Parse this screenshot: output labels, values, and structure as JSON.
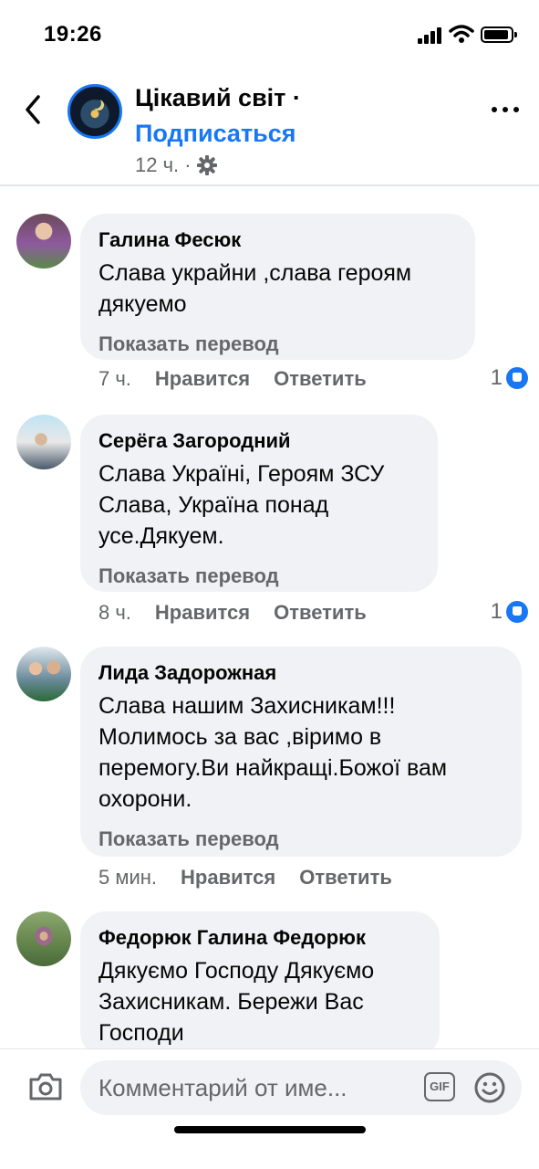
{
  "status_bar": {
    "time": "19:26"
  },
  "header": {
    "page_name": "Цікавий світ ·",
    "subscribe_label": "Подписаться",
    "post_time": "12 ч. ·"
  },
  "comments": [
    {
      "author": "Галина Фесюк",
      "text_lines": [
        "Слава украйни ,слава героям",
        "дякуемо"
      ],
      "translate_label": "Показать перевод",
      "time": "7 ч.",
      "like_label": "Нравится",
      "reply_label": "Ответить",
      "reactions": "1"
    },
    {
      "author": "Серёга Загородний",
      "text_lines": [
        "Слава Україні, Героям ЗСУ",
        "Слава, Україна понад",
        "усе.Дякуем."
      ],
      "translate_label": "Показать перевод",
      "time": "8 ч.",
      "like_label": "Нравится",
      "reply_label": "Ответить",
      "reactions": "1"
    },
    {
      "author": "Лида Задорожная",
      "text_lines": [
        "Слава нашим Захисникам!!!",
        "Молимось за вас ,віримо в",
        "перемогу.Ви найкращі.Божої вам",
        "охорони."
      ],
      "translate_label": "Показать перевод",
      "time": "5 мин.",
      "like_label": "Нравится",
      "reply_label": "Ответить"
    },
    {
      "author": "Федорюк Галина Федорюк",
      "text_lines": [
        "Дякуємо Господу Дякуємо",
        "Захисникам. Бережи Вас",
        "Господи"
      ]
    }
  ],
  "composer": {
    "placeholder": "Комментарий от име...",
    "gif_label": "GIF"
  },
  "colors": {
    "accent": "#1877f2",
    "bubble": "#f0f2f5",
    "muted": "#65676b"
  },
  "icons": [
    "back-chevron-icon",
    "more-icon",
    "gear-icon",
    "like-icon",
    "camera-icon",
    "gif-icon",
    "emoji-icon"
  ]
}
